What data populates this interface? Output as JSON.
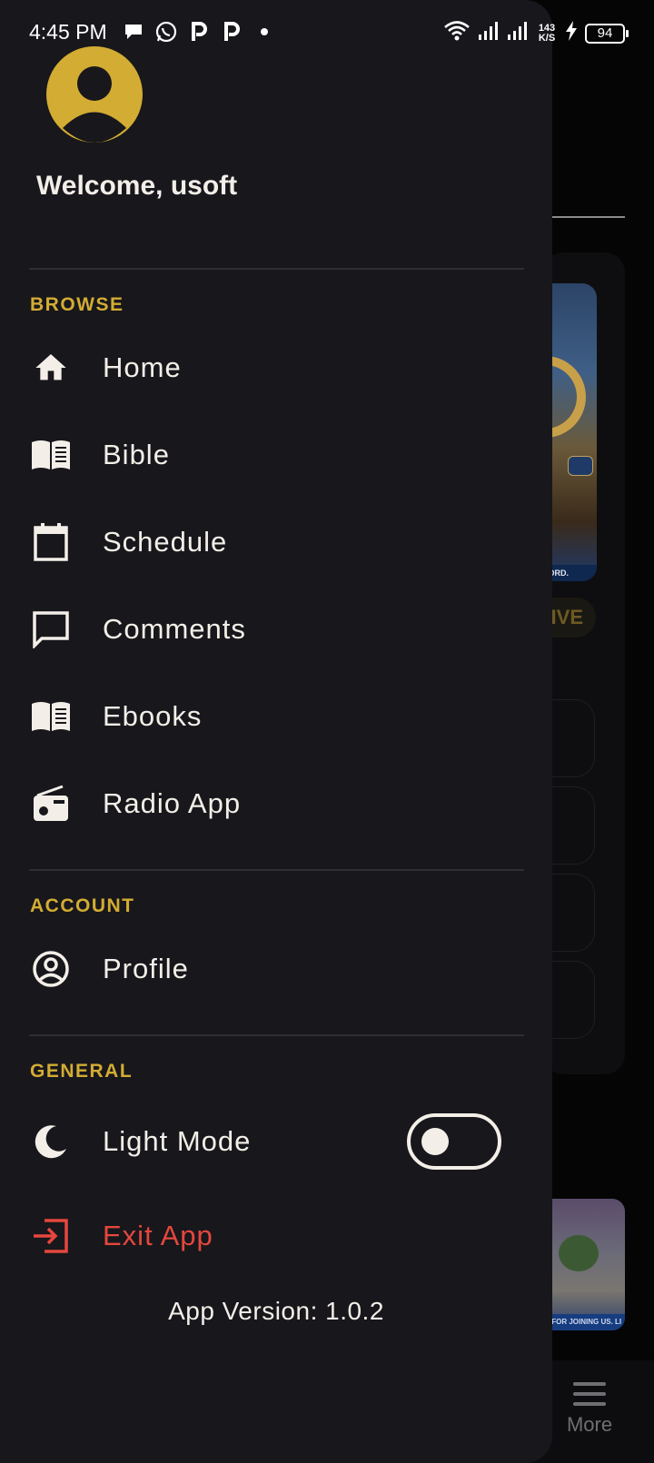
{
  "status_bar": {
    "time": "4:45 PM",
    "left_icons": [
      "chat-bubble-icon",
      "whatsapp-icon",
      "p-app-icon",
      "p-app-icon",
      "dot-icon"
    ],
    "net_speed_value": "143",
    "net_speed_unit": "K/S",
    "battery": "94"
  },
  "drawer": {
    "welcome": "Welcome, usoft",
    "sections": {
      "browse": "BROWSE",
      "account": "ACCOUNT",
      "general": "GENERAL"
    },
    "browse_items": [
      {
        "label": "Home",
        "icon": "home-icon"
      },
      {
        "label": "Bible",
        "icon": "book-icon"
      },
      {
        "label": "Schedule",
        "icon": "calendar-icon"
      },
      {
        "label": "Comments",
        "icon": "comment-icon"
      },
      {
        "label": "Ebooks",
        "icon": "book-icon"
      },
      {
        "label": "Radio App",
        "icon": "radio-icon"
      }
    ],
    "account_items": [
      {
        "label": "Profile",
        "icon": "account-circle-icon"
      }
    ],
    "light_mode": {
      "label": "Light Mode",
      "icon": "moon-icon",
      "enabled": false
    },
    "exit": {
      "label": "Exit App",
      "icon": "exit-icon",
      "color": "#e5473d"
    },
    "app_version": "App Version: 1.0.2"
  },
  "background": {
    "live_badge": "LIVE",
    "hero_caption": "WORD.",
    "thumb_caption": "OU FOR JOINING US. LI",
    "more_label": "More"
  },
  "colors": {
    "accent": "#d3ac33",
    "drawer_bg": "#18171c",
    "text": "#f3efe8",
    "danger": "#e5473d"
  }
}
